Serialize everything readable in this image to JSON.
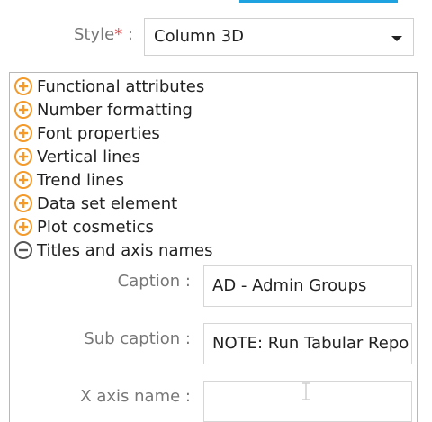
{
  "style_field": {
    "label": "Style",
    "required_mark": "*",
    "colon": ":",
    "selected_value": "Column 3D"
  },
  "tree": {
    "items": [
      {
        "label": "Functional attributes",
        "icon": "expand-plus-icon",
        "state": "collapsed"
      },
      {
        "label": "Number formatting",
        "icon": "expand-plus-icon",
        "state": "collapsed"
      },
      {
        "label": "Font properties",
        "icon": "expand-plus-icon",
        "state": "collapsed"
      },
      {
        "label": "Vertical lines",
        "icon": "expand-plus-icon",
        "state": "collapsed"
      },
      {
        "label": "Trend lines",
        "icon": "expand-plus-icon",
        "state": "collapsed"
      },
      {
        "label": "Data set element",
        "icon": "expand-plus-icon",
        "state": "collapsed"
      },
      {
        "label": "Plot cosmetics",
        "icon": "expand-plus-icon",
        "state": "collapsed"
      },
      {
        "label": "Titles and axis names",
        "icon": "collapse-minus-icon",
        "state": "expanded"
      }
    ]
  },
  "fields": {
    "caption": {
      "label": "Caption",
      "colon": ":",
      "value": "AD - Admin Groups"
    },
    "sub_caption": {
      "label": "Sub caption",
      "colon": ":",
      "value": "NOTE: Run Tabular Repo"
    },
    "x_axis_name": {
      "label": "X axis name",
      "colon": ":",
      "value": ""
    }
  },
  "colors": {
    "accent_orange": "#f39a2b",
    "collapse_gray": "#555555",
    "top_strip_blue": "#1fa3e0",
    "required_red": "#e0484a"
  }
}
